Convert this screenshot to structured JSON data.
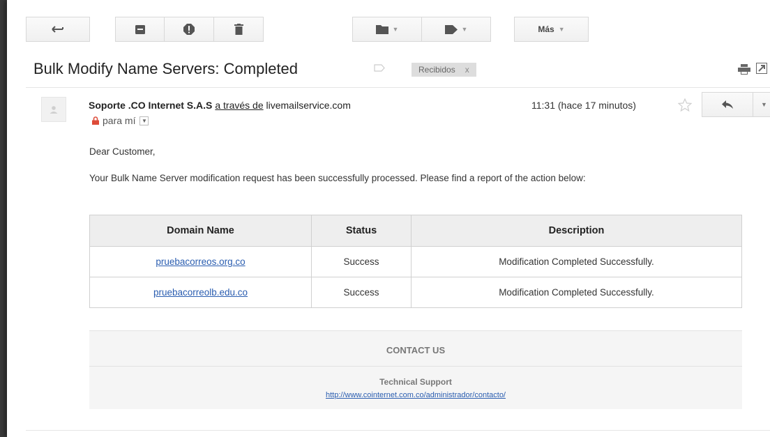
{
  "toolbar": {
    "back_icon": "back-arrow-icon",
    "archive_icon": "archive-icon",
    "spam_icon": "report-spam-icon",
    "delete_icon": "trash-icon",
    "move_icon": "folder-icon",
    "labels_icon": "tag-icon",
    "more_label": "Más"
  },
  "email": {
    "subject": "Bulk Modify Name Servers: Completed",
    "label": "Recibidos",
    "label_remove": "x",
    "sender_name": "Soporte .CO Internet S.A.S",
    "via_text": "a través de",
    "via_domain": "livemailservice.com",
    "to_text": "para mí",
    "time": "11:31 (hace 17 minutos)"
  },
  "body": {
    "greeting": "Dear Customer,",
    "intro": "Your Bulk Name Server modification request has been successfully processed. Please find a report of the action below:",
    "table": {
      "headers": [
        "Domain Name",
        "Status",
        "Description"
      ],
      "rows": [
        [
          "pruebacorreos.org.co",
          "Success",
          "Modification Completed Successfully."
        ],
        [
          "pruebacorreolb.edu.co",
          "Success",
          "Modification Completed Successfully."
        ]
      ]
    },
    "contact": {
      "title": "CONTACT US",
      "support_title": "Technical Support",
      "support_link": "http://www.cointernet.com.co/administrador/contacto/"
    }
  },
  "colors": {
    "link": "#2a5db0",
    "lock": "#dd4b39",
    "label_bg": "#dddddd"
  }
}
